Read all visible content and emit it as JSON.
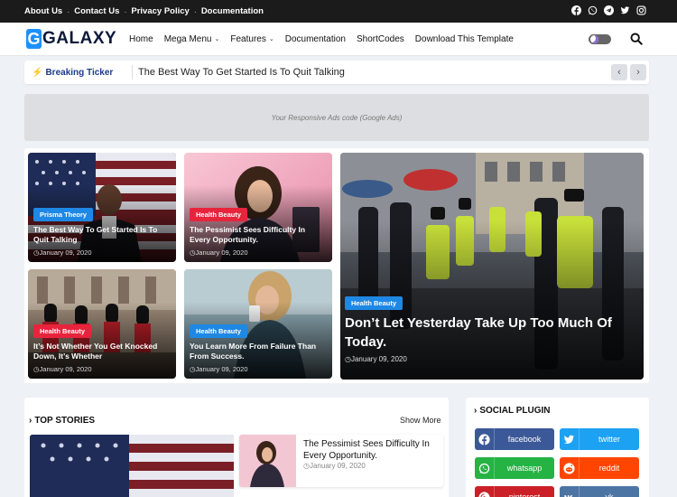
{
  "topbar": {
    "links": [
      "About Us",
      "Contact Us",
      "Privacy Policy",
      "Documentation"
    ],
    "icons": [
      "facebook-icon",
      "whatsapp-icon",
      "telegram-icon",
      "twitter-icon",
      "instagram-icon"
    ]
  },
  "header": {
    "logo_letter": "G",
    "logo_text": "GALAXY",
    "nav": [
      {
        "label": "Home",
        "dropdown": false
      },
      {
        "label": "Mega Menu",
        "dropdown": true
      },
      {
        "label": "Features",
        "dropdown": true
      },
      {
        "label": "Documentation",
        "dropdown": false
      },
      {
        "label": "ShortCodes",
        "dropdown": false
      },
      {
        "label": "Download This Template",
        "dropdown": false
      }
    ],
    "chevron": "⌄"
  },
  "ticker": {
    "label": "Breaking Ticker",
    "headline": "The Best Way To Get Started Is To Quit Talking",
    "prev": "‹",
    "next": "›"
  },
  "ads": {
    "text": "Your Responsive Ads code (Google Ads)"
  },
  "featured": [
    {
      "badge": "Prisma Theory",
      "badge_color": "#1e88e5",
      "title": "The Best Way To Get Started Is To Quit Talking",
      "date": "January 09, 2020"
    },
    {
      "badge": "Health Beauty",
      "badge_color": "#e8243c",
      "title": "The Pessimist Sees Difficulty In Every Opportunity.",
      "date": "January 09, 2020"
    },
    {
      "badge": "Health Beauty",
      "badge_color": "#1e88e5",
      "title": "Don’t Let Yesterday Take Up Too Much Of Today.",
      "date": "January 09, 2020"
    },
    {
      "badge": "Health Beauty",
      "badge_color": "#e8243c",
      "title": "It’s Not Whether You Get Knocked Down, It’s Whether",
      "date": "January 09, 2020"
    },
    {
      "badge": "Health Beauty",
      "badge_color": "#1e88e5",
      "title": "You Learn More From Failure Than From Success.",
      "date": "January 09, 2020"
    }
  ],
  "top_stories": {
    "title": "TOP STORIES",
    "show_more": "Show More",
    "small_story": {
      "title": "The Pessimist Sees Difficulty In Every Opportunity.",
      "date": "January 09, 2020"
    }
  },
  "social_plugin": {
    "title": "SOCIAL PLUGIN",
    "buttons": [
      {
        "label": "facebook",
        "color": "#3b5998",
        "icon": "facebook-icon"
      },
      {
        "label": "twitter",
        "color": "#1da1f2",
        "icon": "twitter-icon"
      },
      {
        "label": "whatsapp",
        "color": "#25b343",
        "icon": "whatsapp-icon"
      },
      {
        "label": "reddit",
        "color": "#ff4500",
        "icon": "reddit-icon"
      },
      {
        "label": "pinterest",
        "color": "#cb2027",
        "icon": "pinterest-icon"
      },
      {
        "label": "vk",
        "color": "#4c75a3",
        "icon": "vk-icon"
      }
    ]
  }
}
